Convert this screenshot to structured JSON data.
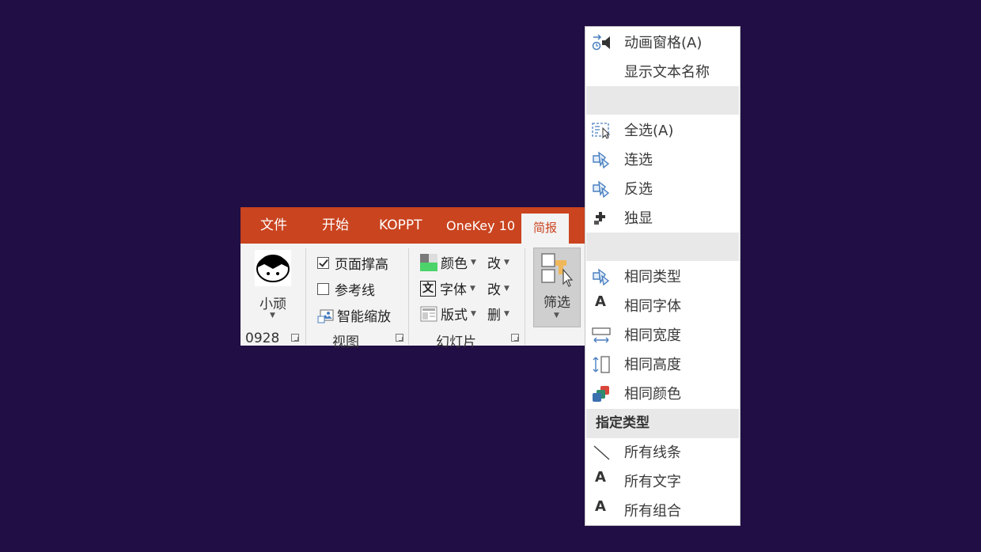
{
  "ribbon": {
    "tabs": [
      "文件",
      "开始",
      "KOPPT",
      "OneKey 10",
      "简报"
    ],
    "active_tab": "简报",
    "user": {
      "name": "小顽",
      "group_label": "0928"
    },
    "view_group": {
      "label": "视图",
      "items": [
        {
          "label": "页面撑高",
          "checked": true
        },
        {
          "label": "参考线",
          "checked": false
        },
        {
          "label": "智能缩放"
        }
      ]
    },
    "slide_group": {
      "label": "幻灯片",
      "items": [
        {
          "label": "颜色",
          "action": "改"
        },
        {
          "label": "字体",
          "action": "改"
        },
        {
          "label": "版式",
          "action": "删"
        }
      ]
    },
    "filter_button": {
      "label": "筛选"
    }
  },
  "menu": {
    "items_top": [
      {
        "label": "动画窗格(A)",
        "icon": "animation-pane-icon"
      },
      {
        "label": "显示文本名称",
        "icon": ""
      }
    ],
    "items_select": [
      {
        "label": "全选(A)",
        "icon": "select-all-icon"
      },
      {
        "label": "连选",
        "icon": "select-connected-icon"
      },
      {
        "label": "反选",
        "icon": "invert-selection-icon"
      },
      {
        "label": "独显",
        "icon": "solo-show-icon"
      }
    ],
    "items_same": [
      {
        "label": "相同类型",
        "icon": "same-type-icon"
      },
      {
        "label": "相同字体",
        "icon": "same-font-icon"
      },
      {
        "label": "相同宽度",
        "icon": "same-width-icon"
      },
      {
        "label": "相同高度",
        "icon": "same-height-icon"
      },
      {
        "label": "相同颜色",
        "icon": "same-color-icon"
      }
    ],
    "section_header": "指定类型",
    "items_type": [
      {
        "label": "所有线条",
        "icon": "line-icon"
      },
      {
        "label": "所有文字",
        "icon": "text-icon"
      },
      {
        "label": "所有组合",
        "icon": "group-icon"
      }
    ],
    "icon_letter": "A"
  },
  "colors": {
    "tab_bar": "#c9441f",
    "ribbon_bg": "#f3f3f3",
    "background": "#200e44",
    "icon_blue": "#4a7fc0"
  }
}
